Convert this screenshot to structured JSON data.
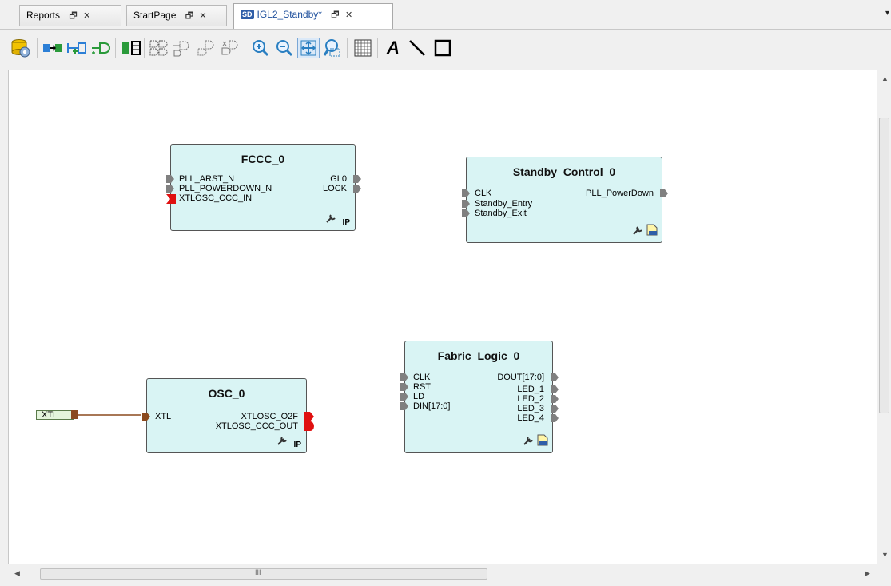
{
  "tabs": [
    {
      "label": "Reports",
      "active": false
    },
    {
      "label": "StartPage",
      "active": false
    },
    {
      "label": "IGL2_Standby*",
      "active": true,
      "badge": "SD"
    }
  ],
  "tab_controls": {
    "float": "🗗",
    "close": "✕",
    "dropdown": "▾"
  },
  "toolbar": {
    "icons": [
      "database-gear-icon",
      "connect-icon",
      "promote-port-icon",
      "add-port-icon",
      "split-icon",
      "group-icon",
      "tie-low-icon",
      "tie-high-icon",
      "mark-unused-icon",
      "zoom-in-icon",
      "zoom-out-icon",
      "fit-icon",
      "zoom-area-icon",
      "grid-icon",
      "text-tool-icon",
      "line-tool-icon",
      "rectangle-tool-icon"
    ],
    "text_tool": "A"
  },
  "blocks": {
    "fccc": {
      "name": "FCCC_0",
      "inputs": [
        "PLL_ARST_N",
        "PLL_POWERDOWN_N",
        "XTLOSC_CCC_IN"
      ],
      "outputs": [
        "GL0",
        "LOCK"
      ],
      "badge": "IP"
    },
    "standby": {
      "name": "Standby_Control_0",
      "inputs": [
        "CLK",
        "Standby_Entry",
        "Standby_Exit"
      ],
      "outputs": [
        "PLL_PowerDown"
      ],
      "badge": "HDL"
    },
    "osc": {
      "name": "OSC_0",
      "inputs": [
        "XTL"
      ],
      "outputs": [
        "XTLOSC_O2F",
        "XTLOSC_CCC_OUT"
      ],
      "badge": "IP"
    },
    "fabric": {
      "name": "Fabric_Logic_0",
      "inputs": [
        "CLK",
        "RST",
        "LD",
        "DIN[17:0]"
      ],
      "outputs": [
        "DOUT[17:0]",
        "LED_1",
        "LED_2",
        "LED_3",
        "LED_4"
      ],
      "badge": "HDL"
    }
  },
  "top_port": {
    "label": "XTL"
  },
  "scrollbar": {
    "h_grip": "III"
  },
  "colors": {
    "block_fill": "#d9f4f4",
    "wire": "#8b4a1e",
    "unconnected_port": "#e01010",
    "port": "#808080"
  }
}
